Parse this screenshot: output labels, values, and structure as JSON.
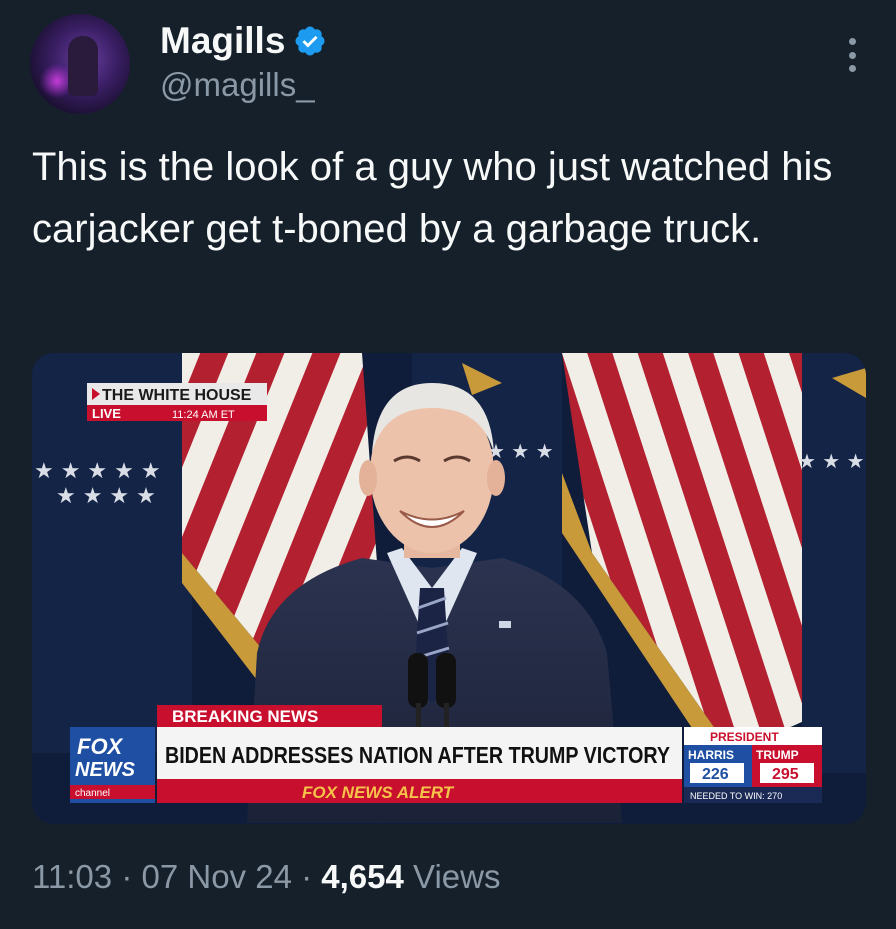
{
  "author": {
    "display_name": "Magills",
    "handle": "@magills_",
    "verified_color": "#1d9bf0"
  },
  "tweet": {
    "text": "This is the look of a guy who just watched his carjacker get t-boned by a garbage truck."
  },
  "media": {
    "location_label": "THE WHITE HOUSE",
    "live_label": "LIVE",
    "time_label": "11:24 AM ET",
    "breaking_label": "BREAKING NEWS",
    "headline": "BIDEN ADDRESSES NATION AFTER TRUMP VICTORY",
    "alert_label": "FOX NEWS ALERT",
    "logo_line1": "FOX",
    "logo_line2": "NEWS",
    "logo_line3": "channel",
    "race_label": "PRESIDENT",
    "candidate_a": "HARRIS",
    "candidate_a_votes": "226",
    "candidate_b": "TRUMP",
    "candidate_b_votes": "295",
    "needed_label": "NEEDED TO WIN: 270"
  },
  "meta": {
    "time": "11:03",
    "date": "07 Nov 24",
    "views_count": "4,654",
    "views_label": "Views",
    "separator": "·"
  },
  "colors": {
    "background": "#15202b",
    "text_primary": "#f7f9f9",
    "text_secondary": "#8b98a5",
    "fox_red": "#c8102e",
    "fox_blue": "#1f4fa3"
  }
}
